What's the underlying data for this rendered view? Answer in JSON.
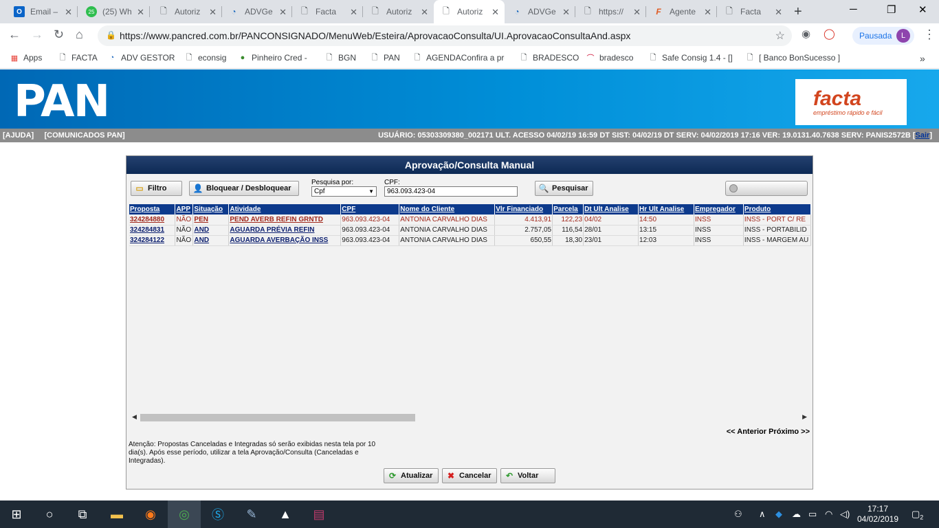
{
  "browser": {
    "tabs": [
      {
        "title": "Email –",
        "icon": "outlook-icon"
      },
      {
        "title": "(25) Wh",
        "icon": "whatsapp-icon"
      },
      {
        "title": "Autoriz",
        "icon": "page-icon"
      },
      {
        "title": "ADVGe",
        "icon": "adv-icon"
      },
      {
        "title": "Facta",
        "icon": "page-icon"
      },
      {
        "title": "Autoriz",
        "icon": "page-icon"
      },
      {
        "title": "Autoriz",
        "icon": "page-icon",
        "active": true
      },
      {
        "title": "ADVGe",
        "icon": "adv-icon"
      },
      {
        "title": "https://",
        "icon": "page-icon"
      },
      {
        "title": "Agente",
        "icon": "facta-icon"
      },
      {
        "title": "Facta",
        "icon": "page-icon"
      }
    ],
    "url": "https://www.pancred.com.br/PANCONSIGNADO/MenuWeb/Esteira/AprovacaoConsulta/UI.AprovacaoConsultaAnd.aspx",
    "profile_label": "Pausada",
    "profile_initial": "L",
    "bookmarks": [
      {
        "label": "Apps",
        "icon": "apps-grid-icon"
      },
      {
        "label": "FACTA",
        "icon": "page-icon"
      },
      {
        "label": "ADV GESTOR",
        "icon": "adv-icon"
      },
      {
        "label": "econsig",
        "icon": "page-icon"
      },
      {
        "label": "Pinheiro Cred -",
        "icon": "globe-icon"
      },
      {
        "label": "BGN",
        "icon": "page-icon"
      },
      {
        "label": "PAN",
        "icon": "page-icon"
      },
      {
        "label": "AGENDAConfira a pro",
        "icon": "page-icon"
      },
      {
        "label": "BRADESCO",
        "icon": "page-icon"
      },
      {
        "label": "bradesco",
        "icon": "bradesco-icon"
      },
      {
        "label": "Safe Consig 1.4 - []",
        "icon": "page-icon"
      },
      {
        "label": "[ Banco BonSucesso ]",
        "icon": "page-icon"
      }
    ]
  },
  "banner": {
    "brand": "PAN",
    "partner_logo": "facta",
    "partner_tagline": "empréstimo rápido e fácil"
  },
  "statusbar": {
    "ajuda": "[AJUDA]",
    "comunicados": "[COMUNICADOS PAN]",
    "info": "USUÁRIO: 05303309380_002171  ULT. ACESSO 04/02/19 16:59  DT SIST: 04/02/19  DT SERV: 04/02/2019 17:16  VER: 19.0131.40.7638  SERV: PANIS2572B  [",
    "sair": "Sair",
    "close_bracket": "]"
  },
  "panel": {
    "title": "Aprovação/Consulta Manual",
    "filtro_label": "Filtro",
    "bloquear_label": "Bloquear / Desbloquear",
    "pesquisa_por_label": "Pesquisa por:",
    "pesquisa_por_value": "Cpf",
    "cpf_label": "CPF:",
    "cpf_value": "963.093.423-04",
    "pesquisar_label": "Pesquisar",
    "pager": "<< Anterior Próximo >>",
    "notice": "Atenção: Propostas Canceladas e Integradas só serão exibidas nesta tela por 10 dia(s). Após esse período, utilizar a tela Aprovação/Consulta (Canceladas e Integradas).",
    "atualizar_label": "Atualizar",
    "cancelar_label": "Cancelar",
    "voltar_label": "Voltar"
  },
  "table": {
    "headers": [
      "Proposta",
      "APP",
      "Situação",
      "Atividade",
      "CPF",
      "Nome do Cliente",
      "Vlr Financiado",
      "Parcela",
      "Dt Ult Analise",
      "Hr Ult Analise",
      "Empregador",
      "Produto"
    ],
    "rows": [
      [
        "324284880",
        "NÃO",
        "PEN",
        "PEND AVERB REFIN GRNTD",
        "963.093.423-04",
        "ANTONIA CARVALHO DIAS",
        "4.413,91",
        "122,23",
        "04/02",
        "14:50",
        "INSS",
        "INSS - PORT C/ RE"
      ],
      [
        "324284831",
        "NÃO",
        "AND",
        "AGUARDA PRÉVIA REFIN",
        "963.093.423-04",
        "ANTONIA CARVALHO DIAS",
        "2.757,05",
        "116,54",
        "28/01",
        "13:15",
        "INSS",
        "INSS - PORTABILID"
      ],
      [
        "324284122",
        "NÃO",
        "AND",
        "AGUARDA AVERBAÇÃO INSS",
        "963.093.423-04",
        "ANTONIA CARVALHO DIAS",
        "650,55",
        "18,30",
        "23/01",
        "12:03",
        "INSS",
        "INSS - MARGEM AU"
      ]
    ]
  },
  "taskbar": {
    "time": "17:17",
    "date": "04/02/2019",
    "notifications": "2"
  }
}
